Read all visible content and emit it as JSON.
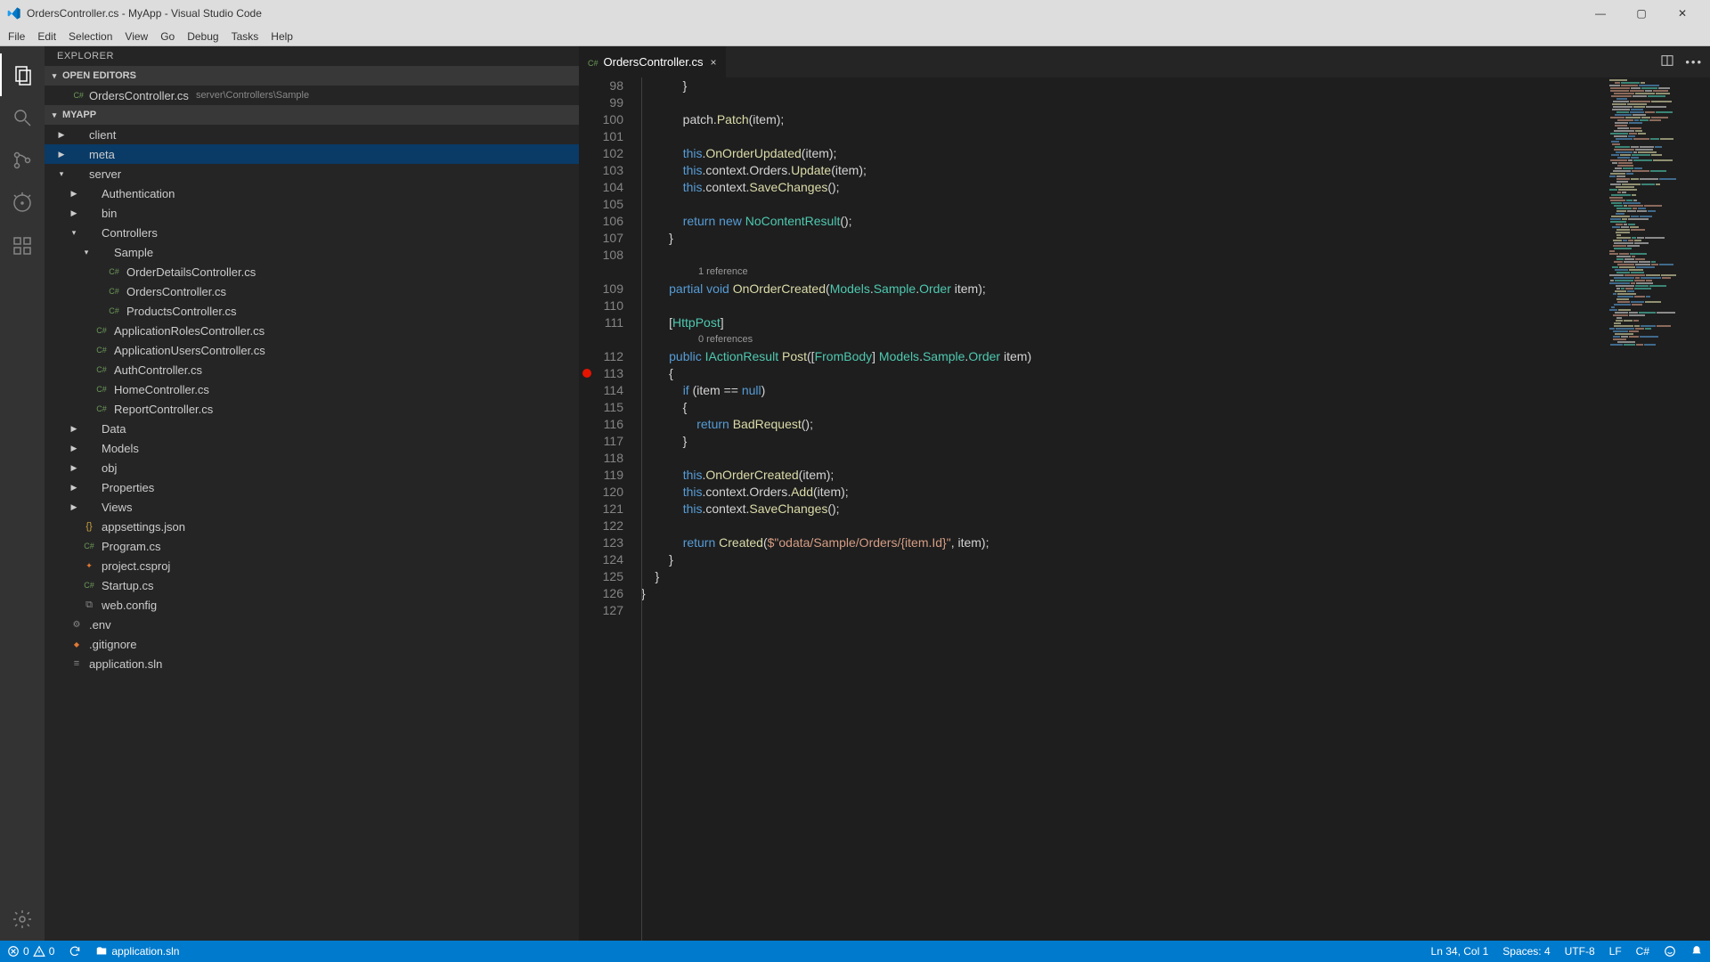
{
  "window": {
    "title": "OrdersController.cs - MyApp - Visual Studio Code"
  },
  "menu": [
    "File",
    "Edit",
    "Selection",
    "View",
    "Go",
    "Debug",
    "Tasks",
    "Help"
  ],
  "explorer": {
    "panel_title": "EXPLORER",
    "open_editors_header": "OPEN EDITORS",
    "open_editors": [
      {
        "name": "OrdersController.cs",
        "path": "server\\Controllers\\Sample"
      }
    ],
    "project_header": "MYAPP",
    "tree": [
      {
        "depth": 0,
        "arrow": "▶",
        "icon": "folder",
        "label": "client"
      },
      {
        "depth": 0,
        "arrow": "▶",
        "icon": "folder",
        "label": "meta",
        "selected": true
      },
      {
        "depth": 0,
        "arrow": "▾",
        "icon": "folder",
        "label": "server"
      },
      {
        "depth": 1,
        "arrow": "▶",
        "icon": "folder",
        "label": "Authentication"
      },
      {
        "depth": 1,
        "arrow": "▶",
        "icon": "folder",
        "label": "bin"
      },
      {
        "depth": 1,
        "arrow": "▾",
        "icon": "folder",
        "label": "Controllers"
      },
      {
        "depth": 2,
        "arrow": "▾",
        "icon": "folder",
        "label": "Sample"
      },
      {
        "depth": 3,
        "arrow": "",
        "icon": "cs",
        "label": "OrderDetailsController.cs"
      },
      {
        "depth": 3,
        "arrow": "",
        "icon": "cs",
        "label": "OrdersController.cs"
      },
      {
        "depth": 3,
        "arrow": "",
        "icon": "cs",
        "label": "ProductsController.cs"
      },
      {
        "depth": 2,
        "arrow": "",
        "icon": "cs",
        "label": "ApplicationRolesController.cs"
      },
      {
        "depth": 2,
        "arrow": "",
        "icon": "cs",
        "label": "ApplicationUsersController.cs"
      },
      {
        "depth": 2,
        "arrow": "",
        "icon": "cs",
        "label": "AuthController.cs"
      },
      {
        "depth": 2,
        "arrow": "",
        "icon": "cs",
        "label": "HomeController.cs"
      },
      {
        "depth": 2,
        "arrow": "",
        "icon": "cs",
        "label": "ReportController.cs"
      },
      {
        "depth": 1,
        "arrow": "▶",
        "icon": "folder",
        "label": "Data"
      },
      {
        "depth": 1,
        "arrow": "▶",
        "icon": "folder",
        "label": "Models"
      },
      {
        "depth": 1,
        "arrow": "▶",
        "icon": "folder",
        "label": "obj"
      },
      {
        "depth": 1,
        "arrow": "▶",
        "icon": "folder",
        "label": "Properties"
      },
      {
        "depth": 1,
        "arrow": "▶",
        "icon": "folder",
        "label": "Views"
      },
      {
        "depth": 1,
        "arrow": "",
        "icon": "json",
        "label": "appsettings.json"
      },
      {
        "depth": 1,
        "arrow": "",
        "icon": "cs",
        "label": "Program.cs"
      },
      {
        "depth": 1,
        "arrow": "",
        "icon": "rss",
        "label": "project.csproj"
      },
      {
        "depth": 1,
        "arrow": "",
        "icon": "cs",
        "label": "Startup.cs"
      },
      {
        "depth": 1,
        "arrow": "",
        "icon": "xml",
        "label": "web.config"
      },
      {
        "depth": 0,
        "arrow": "",
        "icon": "env",
        "label": ".env"
      },
      {
        "depth": 0,
        "arrow": "",
        "icon": "git",
        "label": ".gitignore"
      },
      {
        "depth": 0,
        "arrow": "",
        "icon": "sln",
        "label": "application.sln"
      }
    ]
  },
  "tabs": [
    {
      "name": "OrdersController.cs",
      "icon": "cs",
      "active": true
    }
  ],
  "code": {
    "first_line_number": 98,
    "ref_lens_1": "1 reference",
    "ref_lens_2": "0 references",
    "lines": [
      {
        "n": 98,
        "html": "            }"
      },
      {
        "n": 99,
        "html": ""
      },
      {
        "n": 100,
        "html": "            patch.<span class='tk-fn'>Patch</span>(item);"
      },
      {
        "n": 101,
        "html": ""
      },
      {
        "n": 102,
        "html": "            <span class='tk-this'>this</span>.<span class='tk-fn'>OnOrderUpdated</span>(item);"
      },
      {
        "n": 103,
        "html": "            <span class='tk-this'>this</span>.context.Orders.<span class='tk-fn'>Update</span>(item);"
      },
      {
        "n": 104,
        "html": "            <span class='tk-this'>this</span>.context.<span class='tk-fn'>SaveChanges</span>();"
      },
      {
        "n": 105,
        "html": ""
      },
      {
        "n": 106,
        "html": "            <span class='tk-kw'>return</span> <span class='tk-kw'>new</span> <span class='tk-type'>NoContentResult</span>();"
      },
      {
        "n": 107,
        "html": "        }"
      },
      {
        "n": 108,
        "html": ""
      },
      {
        "lens": "ref_lens_1"
      },
      {
        "n": 109,
        "html": "        <span class='tk-kw'>partial</span> <span class='tk-kw'>void</span> <span class='tk-fn'>OnOrderCreated</span>(<span class='tk-type'>Models</span>.<span class='tk-type'>Sample</span>.<span class='tk-type'>Order</span> item);"
      },
      {
        "n": 110,
        "html": ""
      },
      {
        "n": 111,
        "html": "        [<span class='tk-attr'>HttpPost</span>]"
      },
      {
        "lens": "ref_lens_2"
      },
      {
        "n": 112,
        "html": "        <span class='tk-kw'>public</span> <span class='tk-type'>IActionResult</span> <span class='tk-fn'>Post</span>([<span class='tk-attr'>FromBody</span>] <span class='tk-type'>Models</span>.<span class='tk-type'>Sample</span>.<span class='tk-type'>Order</span> item)"
      },
      {
        "n": 113,
        "html": "        {",
        "breakpoint": true
      },
      {
        "n": 114,
        "html": "            <span class='tk-kw'>if</span> (item == <span class='tk-kw'>null</span>)"
      },
      {
        "n": 115,
        "html": "            {"
      },
      {
        "n": 116,
        "html": "                <span class='tk-kw'>return</span> <span class='tk-fn'>BadRequest</span>();"
      },
      {
        "n": 117,
        "html": "            }"
      },
      {
        "n": 118,
        "html": ""
      },
      {
        "n": 119,
        "html": "            <span class='tk-this'>this</span>.<span class='tk-fn'>OnOrderCreated</span>(item);"
      },
      {
        "n": 120,
        "html": "            <span class='tk-this'>this</span>.context.Orders.<span class='tk-fn'>Add</span>(item);"
      },
      {
        "n": 121,
        "html": "            <span class='tk-this'>this</span>.context.<span class='tk-fn'>SaveChanges</span>();"
      },
      {
        "n": 122,
        "html": ""
      },
      {
        "n": 123,
        "html": "            <span class='tk-kw'>return</span> <span class='tk-fn'>Created</span>(<span class='tk-str'>$\"odata/Sample/Orders/{item.Id}\"</span>, item);"
      },
      {
        "n": 124,
        "html": "        }"
      },
      {
        "n": 125,
        "html": "    }"
      },
      {
        "n": 126,
        "html": "}"
      },
      {
        "n": 127,
        "html": ""
      }
    ]
  },
  "status": {
    "errors": "0",
    "warnings": "0",
    "solution": "application.sln",
    "ln_col": "Ln 34, Col 1",
    "spaces": "Spaces: 4",
    "encoding": "UTF-8",
    "eol": "LF",
    "lang": "C#"
  }
}
